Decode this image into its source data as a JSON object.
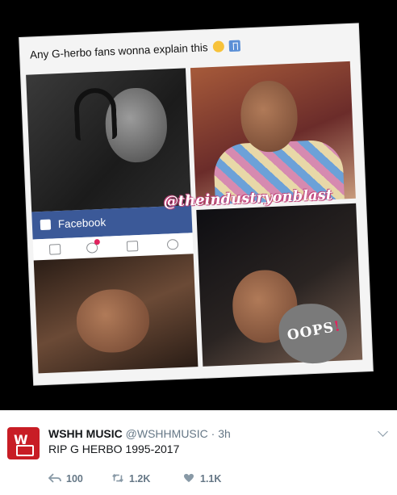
{
  "media": {
    "caption": "Any G-herbo fans wonna explain this",
    "caption_emojis": [
      "face-with-tears-of-joy-icon",
      "share-icon"
    ],
    "facebook_label": "Facebook",
    "watermark": "@theindustryonblast",
    "sticker_main": "OOPS",
    "sticker_mark": "!",
    "notification_color": "#e0245e",
    "facebook_color": "#3b5998"
  },
  "tweet": {
    "display_name": "WSHH MUSIC",
    "handle": "@WSHHMUSIC",
    "separator": " · ",
    "time": "3h",
    "text": "RIP G HERBO 1995-2017",
    "avatar_color": "#c81d25",
    "actions": {
      "reply_count": "100",
      "retweet_count": "1.2K",
      "like_count": "1.1K"
    }
  }
}
